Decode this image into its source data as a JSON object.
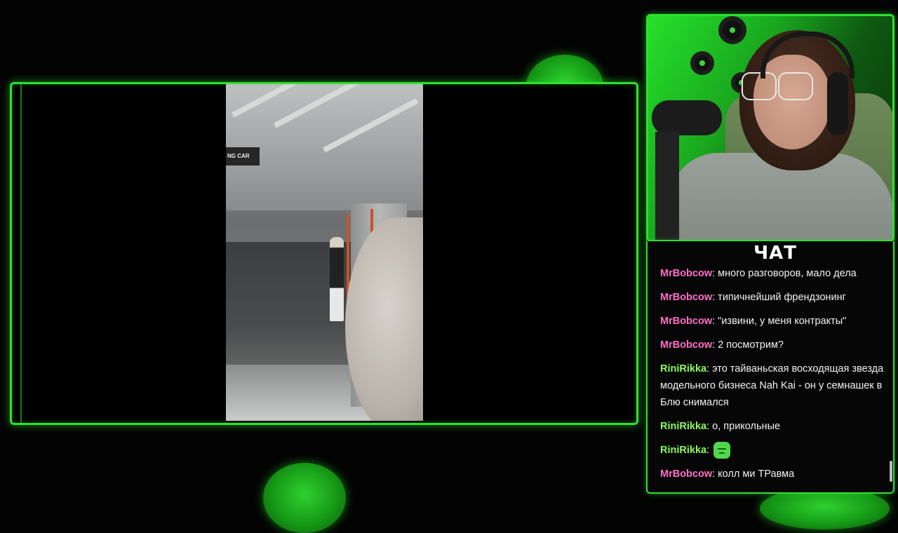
{
  "chat": {
    "title": "ЧАТ",
    "messages": [
      {
        "user": "MrBobcow",
        "color": "#ff6ec7",
        "text": "много разговоров, мало дела"
      },
      {
        "user": "MrBobcow",
        "color": "#ff6ec7",
        "text": "типичнейший френдзонинг"
      },
      {
        "user": "MrBobcow",
        "color": "#ff6ec7",
        "text": "\"извини, у меня контракты\""
      },
      {
        "user": "MrBobcow",
        "color": "#ff6ec7",
        "text": "2 посмотрим?"
      },
      {
        "user": "RiniRikka",
        "color": "#8dfc5a",
        "text": "это тайваньская восходящая звезда модельного бизнеса Nah Kai - он у семнашек в Блю снимался"
      },
      {
        "user": "RiniRikka",
        "color": "#8dfc5a",
        "text": "о, прикольные"
      },
      {
        "user": "RiniRikka",
        "color": "#8dfc5a",
        "text": "",
        "emote": "green-face-emote"
      },
      {
        "user": "MrBobcow",
        "color": "#ff6ec7",
        "text": "колл ми ТРавма"
      }
    ]
  },
  "video": {
    "sign_text": "NG CAR"
  },
  "theme": {
    "accent": "#2fe02f",
    "background": "#030303"
  }
}
